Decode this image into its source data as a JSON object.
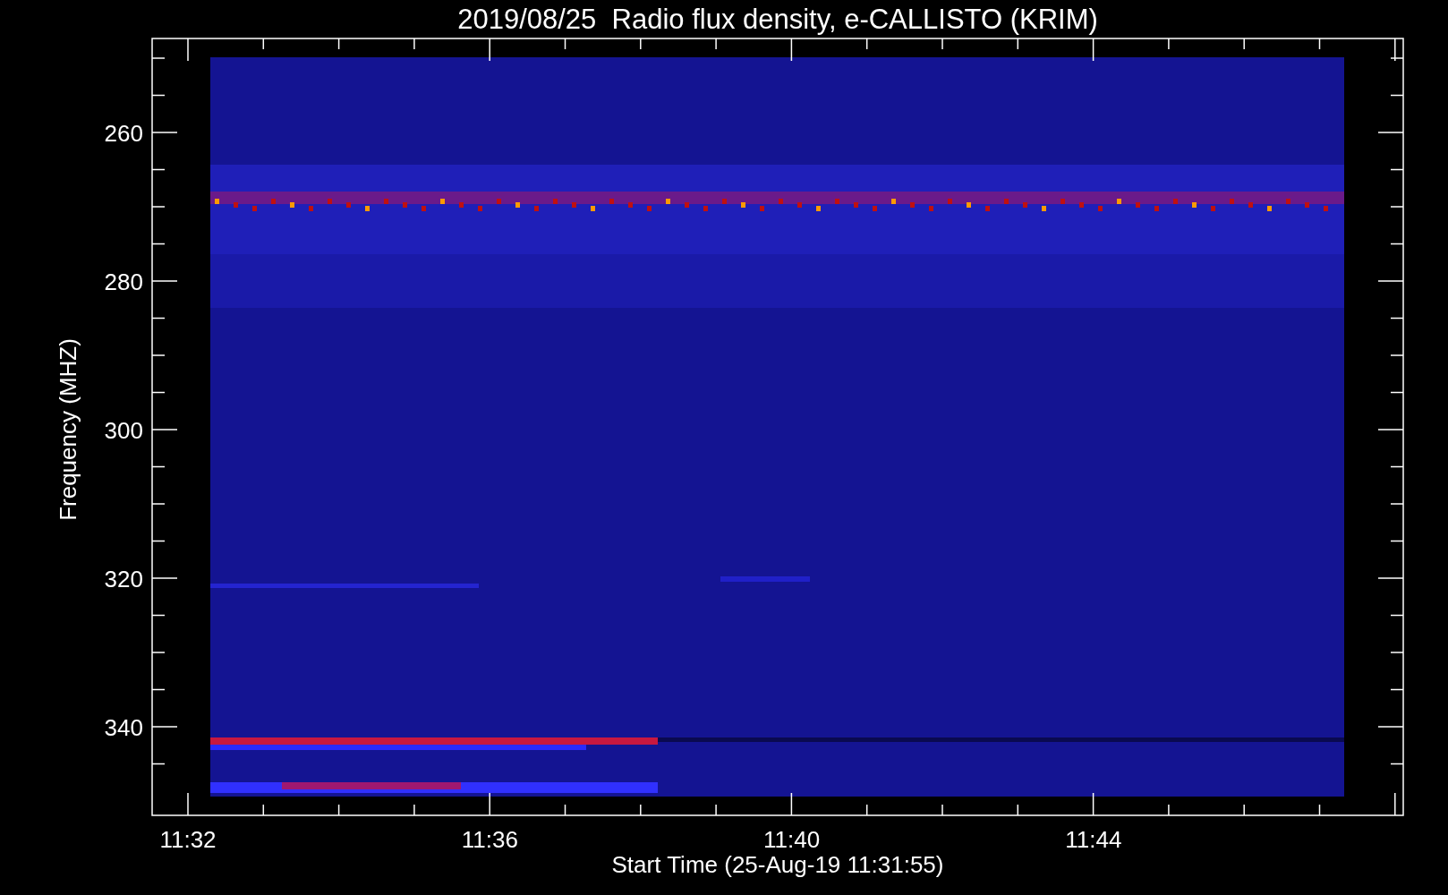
{
  "title": "2019/08/25  Radio flux density, e-CALLISTO (KRIM)",
  "y_axis": {
    "label": "Frequency (MHZ)",
    "ticks": [
      "260",
      "280",
      "300",
      "320",
      "340"
    ]
  },
  "x_axis": {
    "label": "Start Time (25-Aug-19 11:31:55)",
    "ticks": [
      "11:32",
      "11:36",
      "11:40",
      "11:44"
    ]
  }
}
